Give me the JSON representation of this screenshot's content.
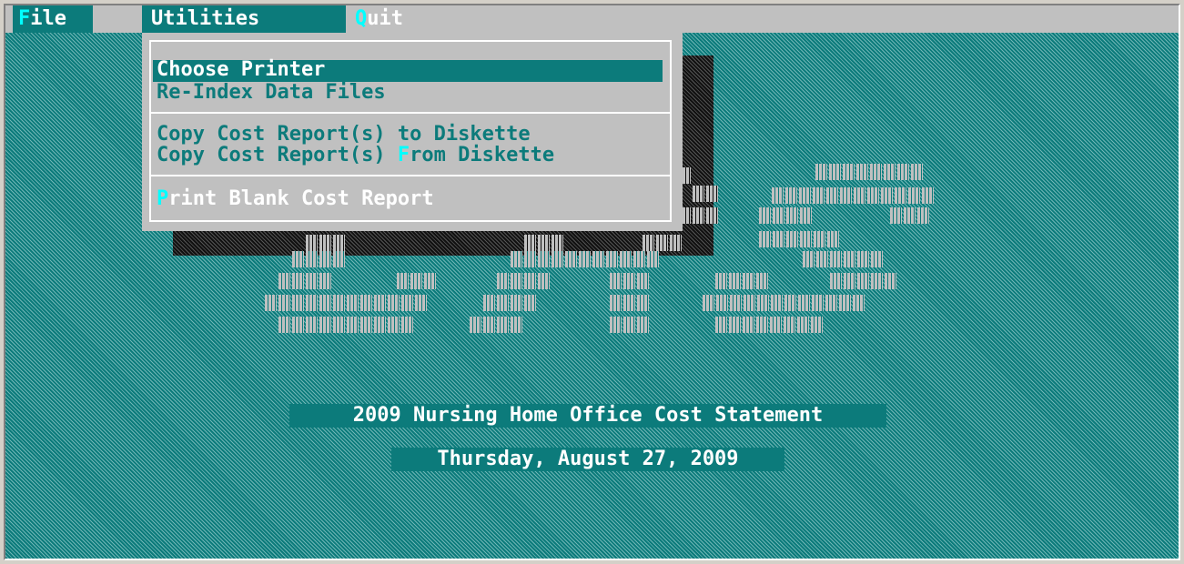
{
  "menubar": {
    "file": {
      "hotkey": "F",
      "rest": "ile"
    },
    "utilities": {
      "label": "Utilities"
    },
    "quit": {
      "hotkey": "Q",
      "rest": "uit"
    }
  },
  "utilities_menu": {
    "items": [
      {
        "label": "Choose Printer",
        "state": "selected"
      },
      {
        "label": "Re-Index Data Files",
        "state": "disabled"
      },
      {
        "label": "Copy Cost Report(s) to Diskette",
        "state": "disabled"
      },
      {
        "label_before": "Copy Cost Report(s) ",
        "hotkey": "F",
        "label_after": "rom Diskette",
        "state": "disabled"
      },
      {
        "hotkey": "P",
        "label_after": "rint Blank Cost Report",
        "state": "enabled"
      }
    ]
  },
  "status": {
    "title": "2009 Nursing Home Office Cost Statement",
    "date": "Thursday, August 27, 2009"
  },
  "colors": {
    "teal": "#0c7b7b",
    "menu_gray": "#c0c0c0",
    "hotkey_cyan": "#00ffff"
  }
}
